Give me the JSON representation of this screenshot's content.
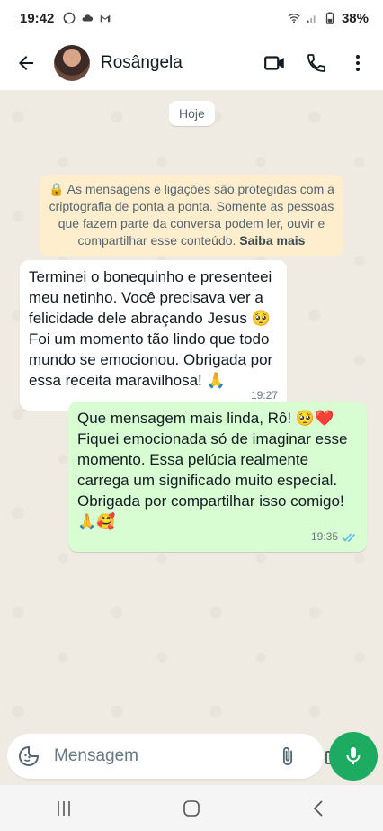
{
  "status_bar": {
    "time": "19:42",
    "battery": "38%",
    "icons": [
      "whatsapp-icon",
      "cloud-icon",
      "gmail-icon",
      "wifi-icon",
      "signal-icon",
      "battery-icon"
    ]
  },
  "header": {
    "contact_name": "Rosângela",
    "icons": [
      "back-arrow-icon",
      "video-call-icon",
      "phone-icon",
      "more-vert-icon"
    ]
  },
  "chat": {
    "date_chip": "Hoje",
    "encryption_notice": {
      "text": "🔒 As mensagens e ligações são protegidas com a criptografia de ponta a ponta. Somente as pessoas que fazem parte da conversa podem ler, ouvir e compartilhar esse conteúdo. ",
      "link": "Saiba mais"
    },
    "messages": [
      {
        "direction": "incoming",
        "text": "Terminei o bonequinho e presenteei meu netinho. Você precisava ver a felicidade dele abraçando Jesus 🥺 Foi um momento tão lindo que todo mundo se emocionou. Obrigada por essa receita maravilhosa! 🙏",
        "time": "19:27"
      },
      {
        "direction": "outgoing",
        "text": "Que mensagem mais linda, Rô! 🥺❤️ Fiquei emocionada só de imaginar esse momento. Essa pelúcia realmente carrega um significado muito especial. Obrigada por compartilhar isso comigo! 🙏🥰",
        "time": "19:35",
        "status": "read"
      }
    ]
  },
  "composer": {
    "placeholder": "Mensagem",
    "value": "",
    "icons": [
      "sticker-icon",
      "attach-icon",
      "camera-icon",
      "mic-icon"
    ]
  },
  "navbar": {
    "icons": [
      "recent-apps-icon",
      "home-icon",
      "back-icon"
    ]
  },
  "colors": {
    "accent": "#1daa61",
    "outgoing_bubble": "#d9fdd3",
    "chat_background": "#efeae2",
    "notice_background": "#ffeecd",
    "read_ticks": "#53bdeb"
  }
}
